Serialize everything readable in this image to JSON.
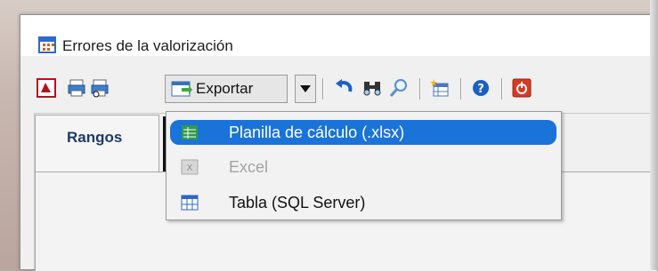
{
  "window": {
    "title": "Errores de la valorización"
  },
  "toolbar": {
    "export_label": "Exportar",
    "icons": [
      "pdf-icon",
      "print-icon",
      "print-preview-icon",
      "export-icon",
      "dropdown-arrow-icon",
      "undo-icon",
      "find-icon",
      "zoom-icon",
      "new-table-icon",
      "help-icon",
      "power-icon"
    ]
  },
  "tabs": {
    "active_label_prefix": "Ran",
    "active_label_underlined": "g",
    "active_label_suffix": "os"
  },
  "export_menu": {
    "items": [
      {
        "label": "Planilla de cálculo (.xlsx)",
        "state": "selected",
        "icon": "spreadsheet-icon"
      },
      {
        "label": "Excel",
        "state": "disabled",
        "icon": "excel-icon"
      },
      {
        "label": "Tabla (SQL Server)",
        "state": "normal",
        "icon": "table-icon"
      }
    ]
  },
  "colors": {
    "selection": "#1a73d9",
    "title_text": "#1c1c1c",
    "tab_text": "#1f3a68",
    "disabled_text": "#a3a3a3"
  }
}
